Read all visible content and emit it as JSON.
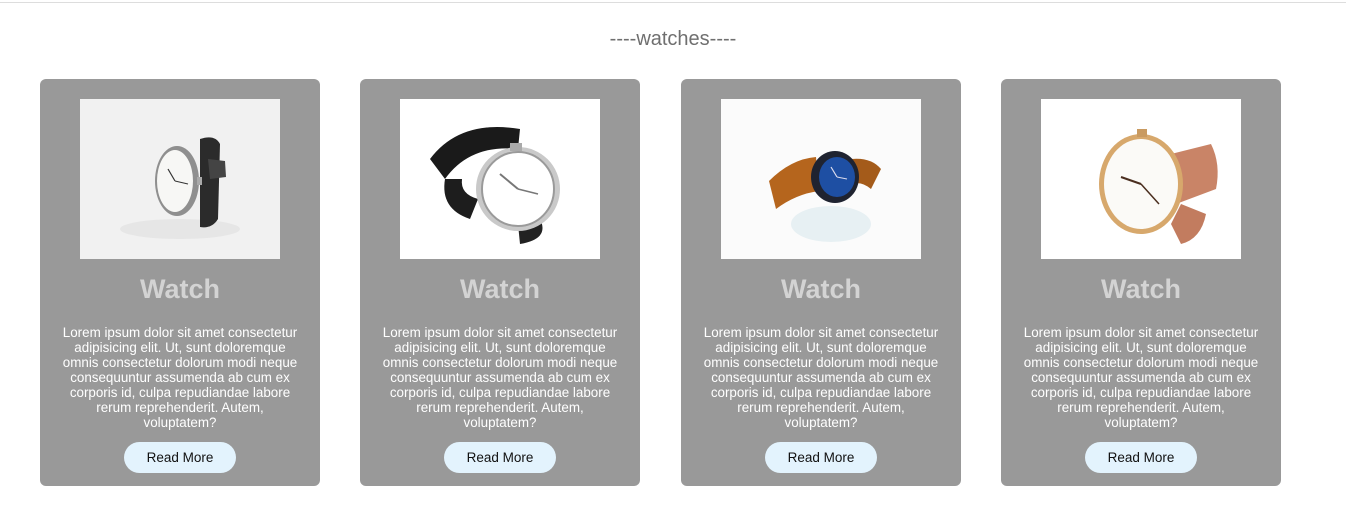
{
  "section": {
    "title": "----watches----"
  },
  "cards": [
    {
      "title": "Watch",
      "description": "Lorem ipsum dolor sit amet consectetur adipisicing elit. Ut, sunt doloremque omnis consectetur dolorum modi neque consequuntur assumenda ab cum ex corporis id, culpa repudiandae labore rerum reprehenderit. Autem, voluptatem?",
      "button_label": "Read More",
      "image": "white-dial-black-strap-watch"
    },
    {
      "title": "Watch",
      "description": "Lorem ipsum dolor sit amet consectetur adipisicing elit. Ut, sunt doloremque omnis consectetur dolorum modi neque consequuntur assumenda ab cum ex corporis id, culpa repudiandae labore rerum reprehenderit. Autem, voluptatem?",
      "button_label": "Read More",
      "image": "silver-watch-black-leather-strap"
    },
    {
      "title": "Watch",
      "description": "Lorem ipsum dolor sit amet consectetur adipisicing elit. Ut, sunt doloremque omnis consectetur dolorum modi neque consequuntur assumenda ab cum ex corporis id, culpa repudiandae labore rerum reprehenderit. Autem, voluptatem?",
      "button_label": "Read More",
      "image": "blue-dial-brown-strap-watch"
    },
    {
      "title": "Watch",
      "description": "Lorem ipsum dolor sit amet consectetur adipisicing elit. Ut, sunt doloremque omnis consectetur dolorum modi neque consequuntur assumenda ab cum ex corporis id, culpa repudiandae labore rerum reprehenderit. Autem, voluptatem?",
      "button_label": "Read More",
      "image": "rose-gold-watch-tan-strap"
    }
  ],
  "colors": {
    "card_bg": "#999999",
    "title_text": "#d3d3d3",
    "button_bg": "#e3f3fd",
    "section_title": "#6f6f6f"
  }
}
